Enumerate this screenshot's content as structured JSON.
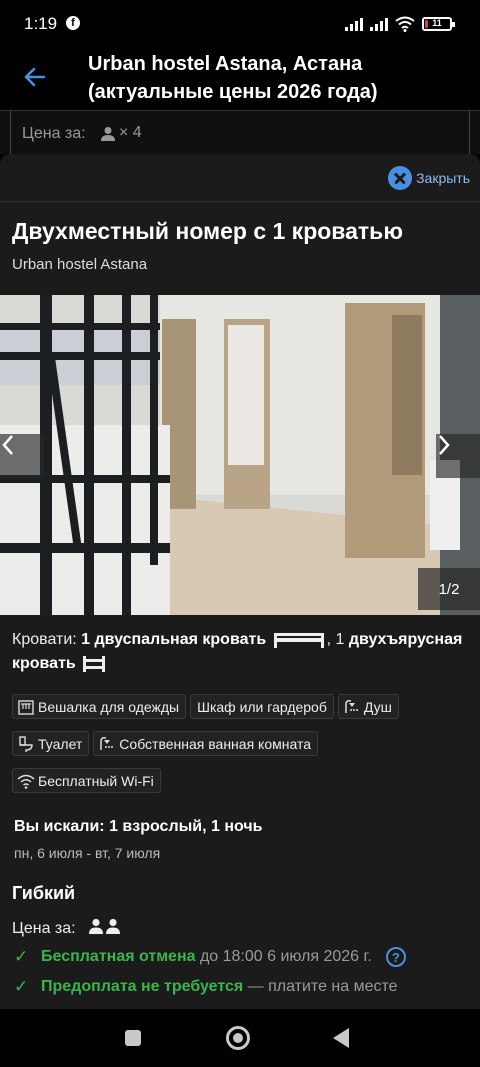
{
  "status_bar": {
    "time": "1:19",
    "battery": "11",
    "battery_level": 0.11
  },
  "header": {
    "title": "Urban hostel Astana, Астана (актуальные цены 2026 года)"
  },
  "underlying_row": {
    "price_label": "Цена за:",
    "multiplier": "× 4"
  },
  "sheet": {
    "close_label": "Закрыть",
    "room_title": "Двухместный номер с 1 кроватью",
    "hostel_name": "Urban hostel Astana",
    "gallery": {
      "counter": "1/2"
    },
    "beds": {
      "prefix": "Кровати:",
      "bed1": "1 двуспальная кровать",
      "separator": ", 1",
      "bed2": "двухъярусная кровать"
    },
    "amenities": [
      {
        "label": "Вешалка для одежды",
        "icon": "hanger-icon"
      },
      {
        "label": "Шкаф или гардероб",
        "icon": ""
      },
      {
        "label": "Душ",
        "icon": "shower-icon"
      },
      {
        "label": "Туалет",
        "icon": "toilet-icon"
      },
      {
        "label": "Собственная ванная комната",
        "icon": "bath-icon"
      },
      {
        "label": "Бесплатный Wi-Fi",
        "icon": "wifi-icon"
      }
    ],
    "search": {
      "summary": "Вы искали: 1 взрослый, 1 ночь",
      "dates": "пн, 6 июля  -  вт, 7 июля"
    },
    "plan": {
      "name": "Гибкий",
      "price_label": "Цена за:",
      "features": [
        {
          "strong": "Бесплатная отмена",
          "rest": " до 18:00 6 июля 2026 г."
        },
        {
          "strong": "Предоплата не требуется",
          "rest": " — платите на месте"
        }
      ]
    }
  },
  "colors": {
    "accent": "#4a90e2",
    "success": "#39b54a",
    "sheet_bg": "#1b1b1b"
  }
}
